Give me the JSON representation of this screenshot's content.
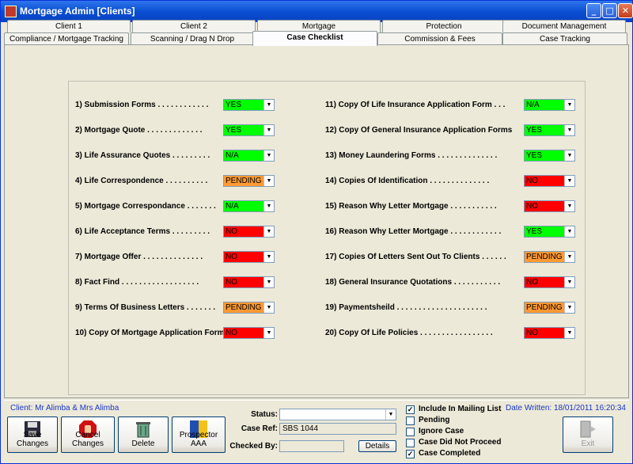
{
  "window": {
    "title": "Mortgage Admin [Clients]"
  },
  "tabs_row1": [
    {
      "label": "Client 1"
    },
    {
      "label": "Client 2"
    },
    {
      "label": "Mortgage"
    },
    {
      "label": "Protection"
    },
    {
      "label": "Document Management"
    }
  ],
  "tabs_row2": [
    {
      "label": "Compliance / Mortgage Tracking"
    },
    {
      "label": "Scanning / Drag N Drop"
    },
    {
      "label": "Case Checklist"
    },
    {
      "label": "Commission & Fees"
    },
    {
      "label": "Case Tracking"
    }
  ],
  "checklist_left": [
    {
      "label": "1) Submission Forms . . . . . . . . . . . .",
      "value": "YES"
    },
    {
      "label": "2) Mortgage Quote . . . . . . . . . . . . .",
      "value": "YES"
    },
    {
      "label": "3) Life Assurance Quotes . . . . . . . . .",
      "value": "N/A"
    },
    {
      "label": "4) Life Correspondence . . . . . . . . . .",
      "value": "PENDING"
    },
    {
      "label": "5) Mortgage Correspondance . . . . . . .",
      "value": "N/A"
    },
    {
      "label": "6) Life Acceptance Terms . . . . . . . . .",
      "value": "NO"
    },
    {
      "label": "7) Mortgage Offer . . . . . . . . . . . . . .",
      "value": "NO"
    },
    {
      "label": "8) Fact Find . . . . . . . . . . . . . . . . . .",
      "value": "NO"
    },
    {
      "label": "9) Terms Of Business Letters . . . . . . .",
      "value": "PENDING"
    },
    {
      "label": "10) Copy Of Mortgage Application Form",
      "value": "NO"
    }
  ],
  "checklist_right": [
    {
      "label": "11) Copy Of Life Insurance Application Form . . .",
      "value": "N/A"
    },
    {
      "label": "12) Copy Of General Insurance Application Forms",
      "value": "YES"
    },
    {
      "label": "13) Money Laundering Forms . . . . . . . . . . . . . .",
      "value": "YES"
    },
    {
      "label": "14) Copies Of Identification . . . . . . . . . . . . . .",
      "value": "NO"
    },
    {
      "label": "15) Reason Why Letter Mortgage . . . . . . . . . . .",
      "value": "NO"
    },
    {
      "label": "16) Reason Why Letter Mortgage . . . . . . . . . . . .",
      "value": "YES"
    },
    {
      "label": "17) Copies Of Letters Sent Out To Clients . . . . . .",
      "value": "PENDING"
    },
    {
      "label": "18) General Insurance Quotations . . . . . . . . . . .",
      "value": "NO"
    },
    {
      "label": "19) Paymentsheild . . . . . . . . . . . . . . . . . . . . .",
      "value": "PENDING"
    },
    {
      "label": "20) Copy Of Life Policies . . . . . . . . . . . . . . . . .",
      "value": "NO"
    }
  ],
  "status_colors": {
    "YES": "#00ff00",
    "N/A": "#00ff00",
    "PENDING": "#ff9933",
    "NO": "#ff0000"
  },
  "footer": {
    "client": "Client: Mr Alimba & Mrs Alimba",
    "date_written": "Date Written: 18/01/2011 16:20:34",
    "buttons": {
      "save": "Save Changes",
      "cancel": "Cancel Changes",
      "delete": "Delete",
      "prospector": "Prospector AAA",
      "exit": "Exit"
    },
    "status_label": "Status:",
    "status_value": "",
    "case_ref_label": "Case Ref:",
    "case_ref_value": "SBS 1044",
    "checked_by_label": "Checked By:",
    "checked_by_value": "",
    "details_button": "Details",
    "checkboxes": [
      {
        "label": "Include In Mailing List",
        "checked": true
      },
      {
        "label": "Pending",
        "checked": false
      },
      {
        "label": "Ignore Case",
        "checked": false
      },
      {
        "label": "Case Did Not Proceed",
        "checked": false
      },
      {
        "label": "Case Completed",
        "checked": true
      }
    ]
  }
}
